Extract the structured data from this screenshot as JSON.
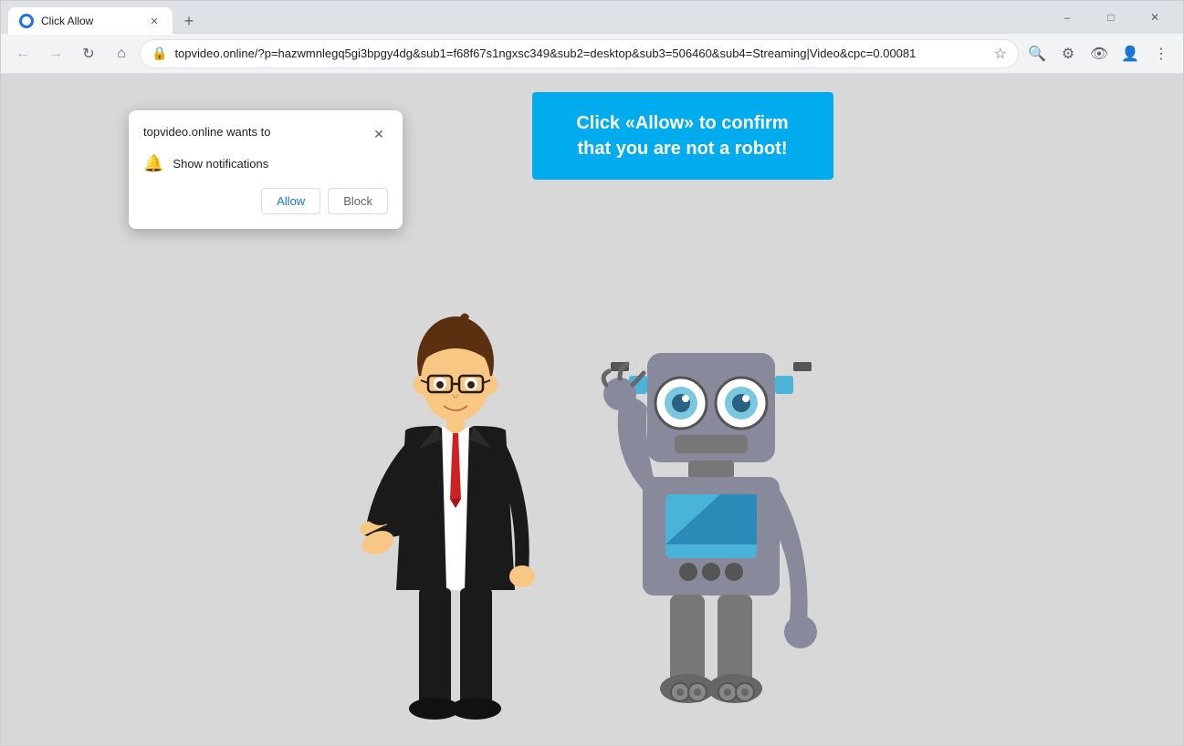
{
  "window": {
    "tab_title": "Click Allow",
    "tab_favicon": "browser-icon",
    "close_btn": "✕",
    "minimize_btn": "–",
    "maximize_btn": "□"
  },
  "toolbar": {
    "back_icon": "←",
    "forward_icon": "→",
    "reload_icon": "↻",
    "home_icon": "⌂",
    "address": "topvideo.online/?p=hazwmnlegq5gi3bpgy4dg&sub1=f68f67s1ngxsc349&sub2=desktop&sub3=506460&sub4=Streaming|Video&cpc=0.00081",
    "lock_icon": "🔒",
    "star_icon": "☆",
    "zoom_icon": "🔍",
    "shield_icon": "⚙",
    "eye_icon": "👁",
    "account_icon": "👤",
    "menu_icon": "⋮"
  },
  "notification_popup": {
    "title": "topvideo.online wants to",
    "close_icon": "✕",
    "notification_row": {
      "bell_icon": "🔔",
      "text": "Show notifications"
    },
    "allow_button": "Allow",
    "block_button": "Block"
  },
  "banner": {
    "line1": "Click «Allow» to confirm",
    "line2": "that you are not a robot!"
  },
  "page": {
    "background_color": "#d4d4d4"
  }
}
